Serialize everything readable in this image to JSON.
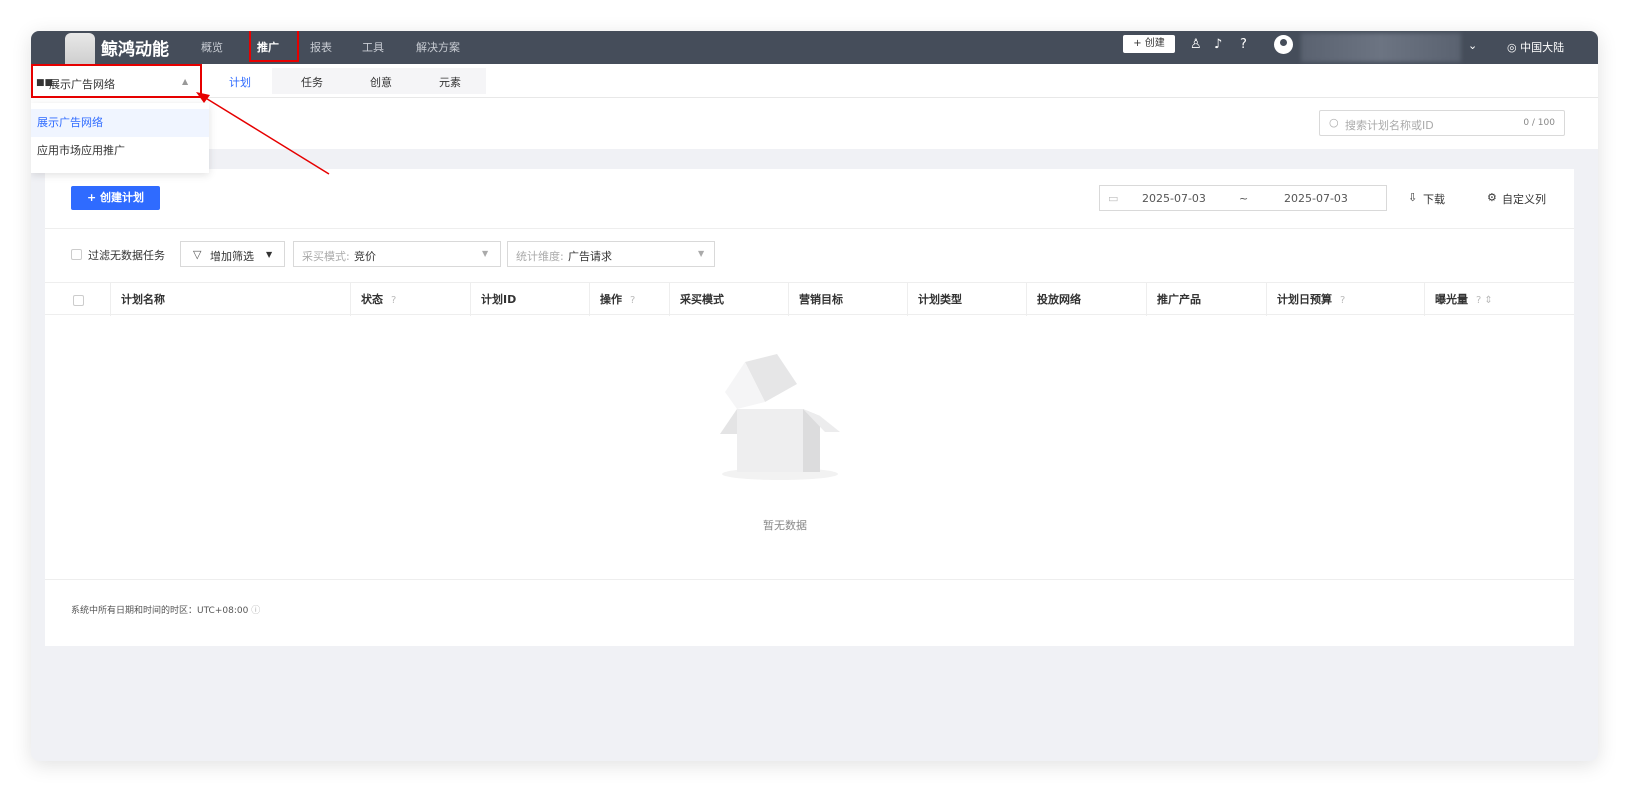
{
  "brand": "鲸鸿动能",
  "nav": [
    "概览",
    "推广",
    "报表",
    "工具",
    "解决方案"
  ],
  "topbar": {
    "create_label": "+ 创建",
    "region": "◎ 中国大陆",
    "user_caret": "⌄"
  },
  "network_select": {
    "value": "展示广告网络",
    "options": [
      "展示广告网络",
      "应用市场应用推广"
    ]
  },
  "subtabs": [
    "计划",
    "任务",
    "创意",
    "元素"
  ],
  "search": {
    "placeholder": "搜索计划名称或ID",
    "count": "0 / 100"
  },
  "toolbar": {
    "create_plan": "+ 创建计划",
    "date_start": "2025-07-03",
    "date_sep": "~",
    "date_end": "2025-07-03",
    "download": "下载",
    "customize": "自定义列"
  },
  "filters": {
    "no_data_label": "过滤无数据任务",
    "add_filter": "增加筛选",
    "buy_mode_label": "采买模式:",
    "buy_mode_value": "竞价",
    "stat_dim_label": "统计维度:",
    "stat_dim_value": "广告请求"
  },
  "columns": [
    "计划名称",
    "状态",
    "计划ID",
    "操作",
    "采买模式",
    "营销目标",
    "计划类型",
    "投放网络",
    "推广产品",
    "计划日预算",
    "曝光量"
  ],
  "empty_text": "暂无数据",
  "timezone_note": "系统中所有日期和时间的时区：UTC+08:00"
}
